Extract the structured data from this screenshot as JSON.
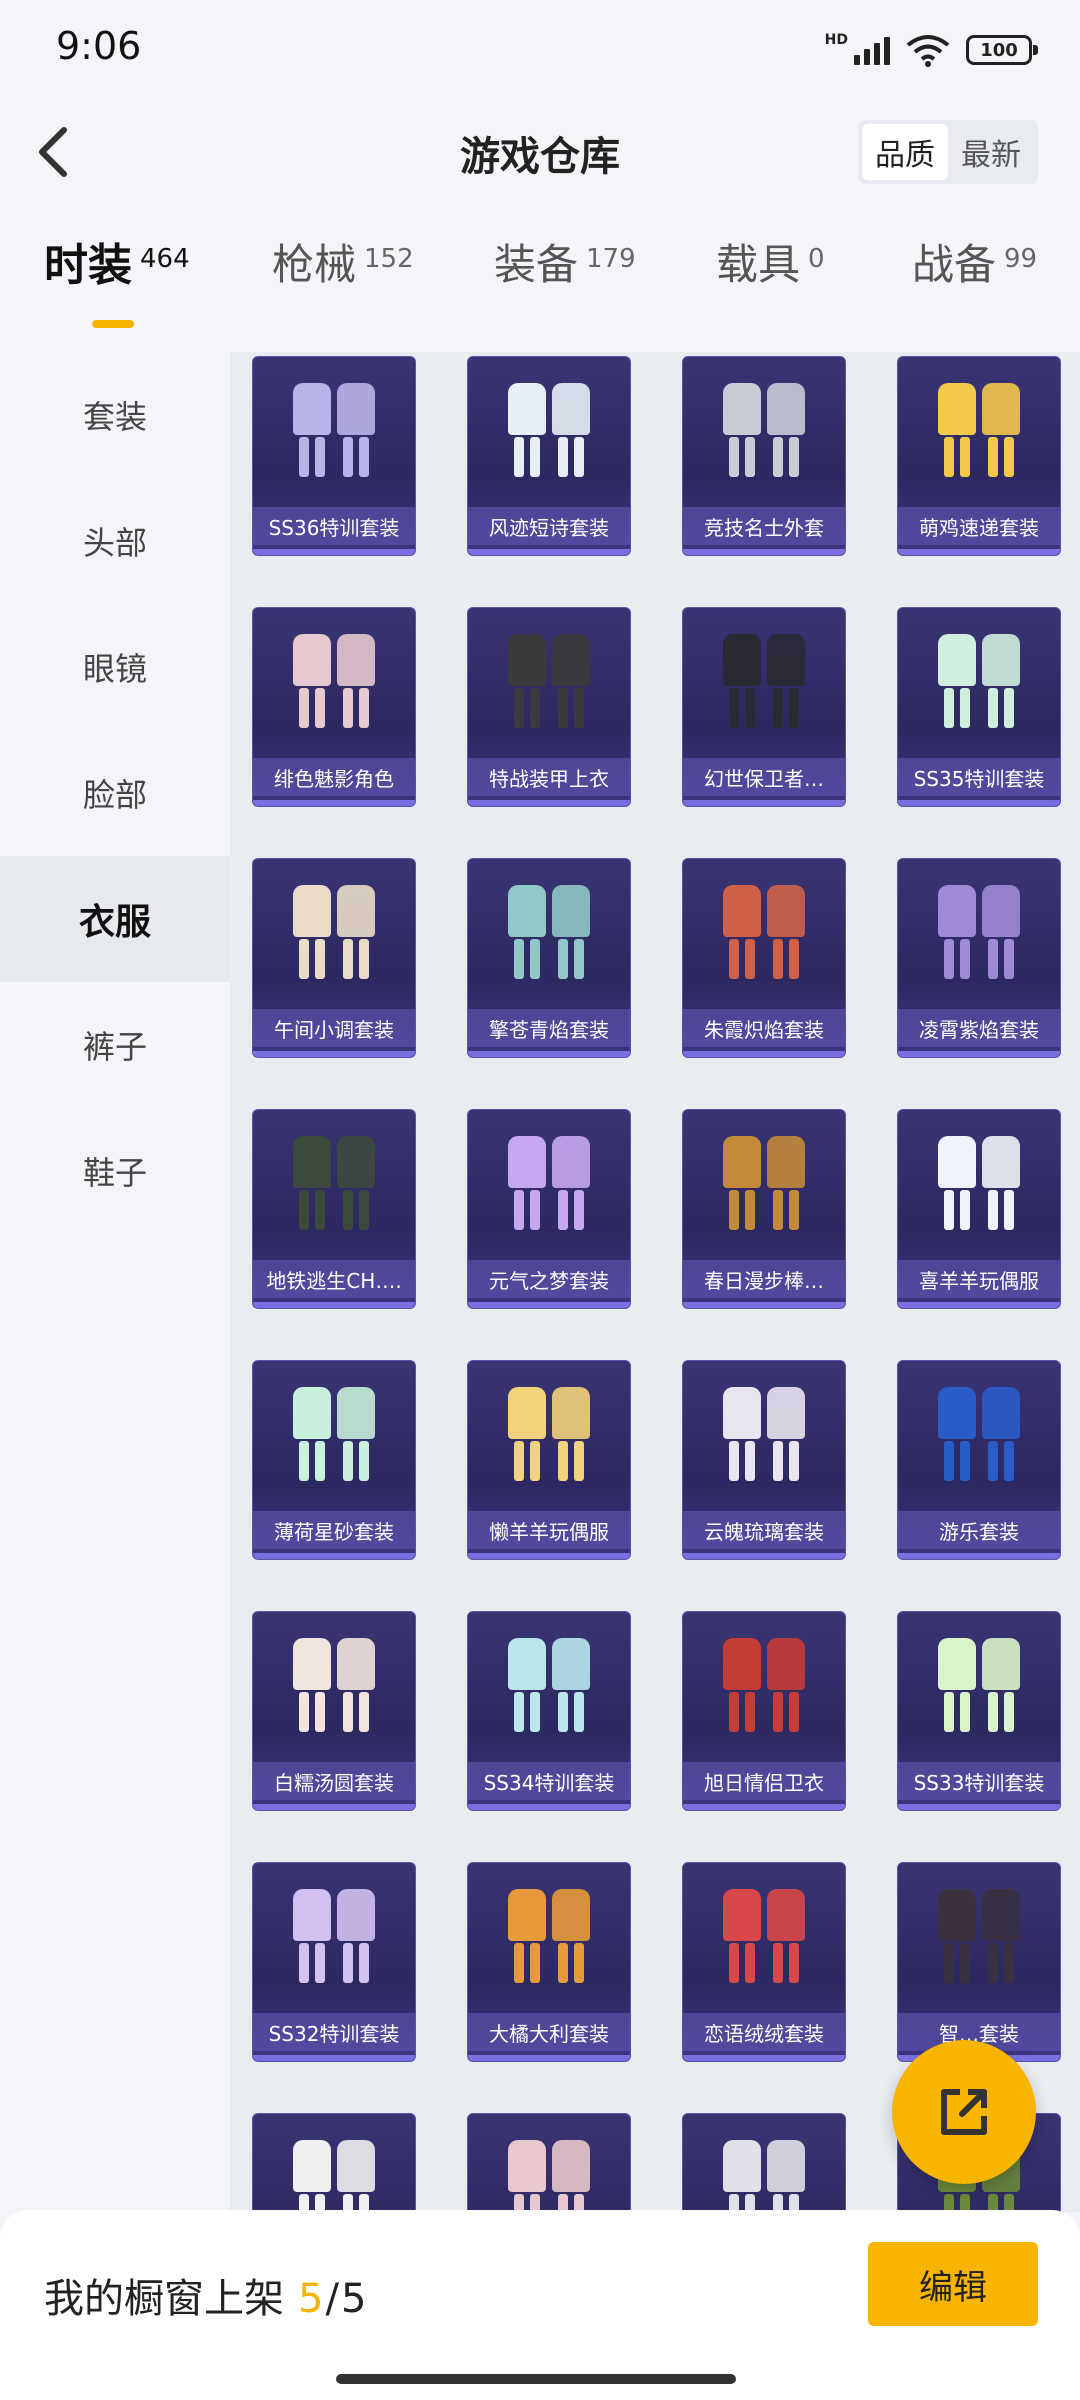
{
  "status": {
    "time": "9:06",
    "hd": "HD",
    "battery": "100"
  },
  "header": {
    "title": "游戏仓库",
    "sort": [
      "品质",
      "最新"
    ],
    "active_sort": 0
  },
  "tabs": [
    {
      "label": "时装",
      "count": "464",
      "active": true
    },
    {
      "label": "枪械",
      "count": "152"
    },
    {
      "label": "装备",
      "count": "179"
    },
    {
      "label": "载具",
      "count": "0"
    },
    {
      "label": "战备",
      "count": "99"
    }
  ],
  "sidebar": {
    "items": [
      "套装",
      "头部",
      "眼镜",
      "脸部",
      "衣服",
      "裤子",
      "鞋子"
    ],
    "active_index": 4
  },
  "items": [
    {
      "name": "SS36特训套装",
      "color": "#b9b4e8"
    },
    {
      "name": "风迹短诗套装",
      "color": "#e8eef6"
    },
    {
      "name": "竞技名士外套",
      "color": "#c8ccd6"
    },
    {
      "name": "萌鸡速递套装",
      "color": "#f4c84a"
    },
    {
      "name": "绯色魅影角色",
      "color": "#e6c8cf"
    },
    {
      "name": "特战装甲上衣",
      "color": "#3a3a3a"
    },
    {
      "name": "幻世保卫者…",
      "color": "#2a2a34"
    },
    {
      "name": "SS35特训套装",
      "color": "#cfeede"
    },
    {
      "name": "午间小调套装",
      "color": "#e9dcc6"
    },
    {
      "name": "擎苍青焰套装",
      "color": "#8fc8c4"
    },
    {
      "name": "朱霞炽焰套装",
      "color": "#d06048"
    },
    {
      "name": "凌霄紫焰套装",
      "color": "#a08ad8"
    },
    {
      "name": "地铁逃生CH….",
      "color": "#3c4a3c"
    },
    {
      "name": "元气之梦套装",
      "color": "#c7a8f0"
    },
    {
      "name": "春日漫步棒…",
      "color": "#c38a3a"
    },
    {
      "name": "喜羊羊玩偶服",
      "color": "#f0f4fa"
    },
    {
      "name": "薄荷星砂套装",
      "color": "#c8f0dc"
    },
    {
      "name": "懒羊羊玩偶服",
      "color": "#f2d27a"
    },
    {
      "name": "云魄琉璃套装",
      "color": "#e8e4f0"
    },
    {
      "name": "游乐套装",
      "color": "#2a5cc8"
    },
    {
      "name": "白糯汤圆套装",
      "color": "#f0e4dc"
    },
    {
      "name": "SS34特训套装",
      "color": "#b8e8ec"
    },
    {
      "name": "旭日情侣卫衣",
      "color": "#c43c34"
    },
    {
      "name": "SS33特训套装",
      "color": "#d8f4c8"
    },
    {
      "name": "SS32特训套装",
      "color": "#d2c0f0"
    },
    {
      "name": "大橘大利套装",
      "color": "#e89a3a"
    },
    {
      "name": "恋语绒绒套装",
      "color": "#d84848"
    },
    {
      "name": "智…套装",
      "color": "#3a3040"
    },
    {
      "name": "",
      "color": "#f0f0f0"
    },
    {
      "name": "",
      "color": "#e8c8cc"
    },
    {
      "name": "",
      "color": "#e0e0e8"
    },
    {
      "name": "",
      "color": "#6a8a3a"
    }
  ],
  "bottom": {
    "showcase_label": "我的橱窗上架",
    "current": "5",
    "separator": "/",
    "total": "5",
    "edit_label": "编辑"
  }
}
